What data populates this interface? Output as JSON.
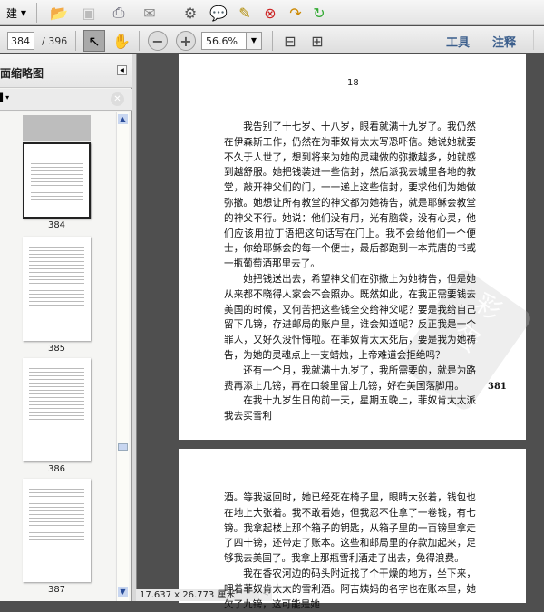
{
  "toolbar": {
    "create_label": "建",
    "icons": [
      "open-icon",
      "save-icon",
      "print-icon",
      "email-icon",
      "settings-icon",
      "comment-icon",
      "highlight-icon",
      "delete-page-icon",
      "export-icon",
      "share-icon"
    ],
    "page_current": "384",
    "page_total": "/ 396",
    "zoom": "56.6%",
    "tools_label": "工具",
    "comment_label": "注释"
  },
  "sidebar": {
    "title": "页面缩略图",
    "thumbnails": [
      {
        "label": "384"
      },
      {
        "label": "385"
      },
      {
        "label": "386"
      },
      {
        "label": "387"
      }
    ]
  },
  "document": {
    "page1": {
      "header_number": "18",
      "paragraphs": [
        "我告别了十七岁、十八岁，眼看就满十九岁了。我仍然在伊森斯工作，仍然在为菲奴肯太太写恐吓信。她说她就要不久于人世了，想到将来为她的灵魂做的弥撒越多，她就感到越舒服。她把钱装进一些信封，然后派我去城里各地的教堂，敲开神父们的门，一一递上这些信封，要求他们为她做弥撒。她想让所有教堂的神父都为她祷告，就是耶稣会教堂的神父不行。她说：他们没有用，光有脑袋，没有心灵，他们应该用拉丁语把这句话写在门上。我不会给他们一个便士，你给耶稣会的每一个便士，最后都跑到一本荒唐的书或一瓶葡萄酒那里去了。",
        "她把钱送出去，希望神父们在弥撒上为她祷告，但是她从来都不晓得人家会不会照办。既然如此，在我正需要钱去美国的时候，又何苦把这些钱全交给神父呢？要是我给自己留下几镑，存进邮局的账户里，谁会知道呢？反正我是一个罪人，又好久没忏悔啦。在菲奴肯太太死后，要是我为她祷告，为她的灵魂点上一支蜡烛，上帝难道会拒绝吗？",
        "还有一个月，我就满十九岁了，我所需要的，就是为路费再添上几镑，再在口袋里留上几镑，好在美国落脚用。",
        "在我十九岁生日的前一天，星期五晚上，菲奴肯太太派我去买雪利"
      ],
      "footer_number": "381"
    },
    "page2": {
      "paragraphs": [
        "酒。等我返回时，她已经死在椅子里，眼睛大张着，钱包也在地上大张着。我不敢看她，但我忍不住拿了一卷钱，有七镑。我拿起楼上那个箱子的钥匙，从箱子里的一百镑里拿走了四十镑，还带走了账本。这些和邮局里的存款加起来，足够我去美国了。我拿上那瓶雪利酒走了出去，免得浪费。",
        "我在香农河边的码头附近找了个干燥的地方，坐下来，呷着菲奴肯太太的雪利酒。阿吉姨妈的名字也在账本里，她欠了九镑，这可能是她"
      ]
    }
  },
  "status": {
    "page_size": "17.637 x 26.773 厘米"
  }
}
